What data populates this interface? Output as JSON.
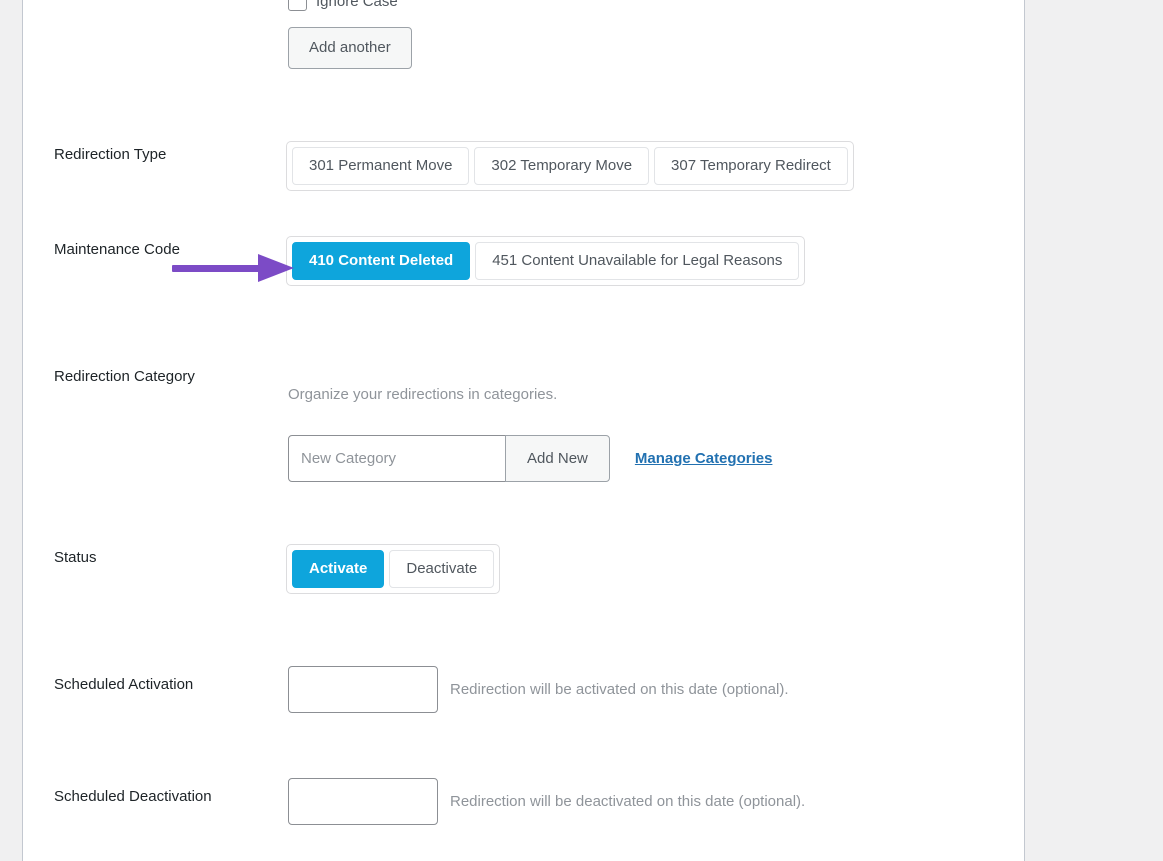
{
  "colors": {
    "accent_blue": "#0ea5dc",
    "link_blue": "#2271b1",
    "annotation_purple": "#7c4bc6",
    "panel_background": "#ffffff",
    "page_background": "#f0f0f1",
    "label_text": "#1d2327",
    "muted_text": "#8f949a"
  },
  "source_group": {
    "ignore_case_label": "Ignore Case",
    "ignore_case_checked": false,
    "add_another_label": "Add another"
  },
  "redirection_type": {
    "label": "Redirection Type",
    "options": [
      {
        "label": "301 Permanent Move",
        "selected": false
      },
      {
        "label": "302 Temporary Move",
        "selected": false
      },
      {
        "label": "307 Temporary Redirect",
        "selected": false
      }
    ]
  },
  "maintenance_code": {
    "label": "Maintenance Code",
    "options": [
      {
        "label": "410 Content Deleted",
        "selected": true
      },
      {
        "label": "451 Content Unavailable for Legal Reasons",
        "selected": false
      }
    ],
    "annotation": "arrow pointing at 410 Content Deleted"
  },
  "redirection_category": {
    "label": "Redirection Category",
    "description": "Organize your redirections in categories.",
    "new_category_value": "",
    "new_category_placeholder": "New Category",
    "add_new_label": "Add New",
    "manage_categories_label": "Manage Categories"
  },
  "status": {
    "label": "Status",
    "options": [
      {
        "label": "Activate",
        "selected": true
      },
      {
        "label": "Deactivate",
        "selected": false
      }
    ]
  },
  "scheduled_activation": {
    "label": "Scheduled Activation",
    "value": "",
    "placeholder": "",
    "help": "Redirection will be activated on this date (optional)."
  },
  "scheduled_deactivation": {
    "label": "Scheduled Deactivation",
    "value": "",
    "placeholder": "",
    "help": "Redirection will be deactivated on this date (optional)."
  }
}
